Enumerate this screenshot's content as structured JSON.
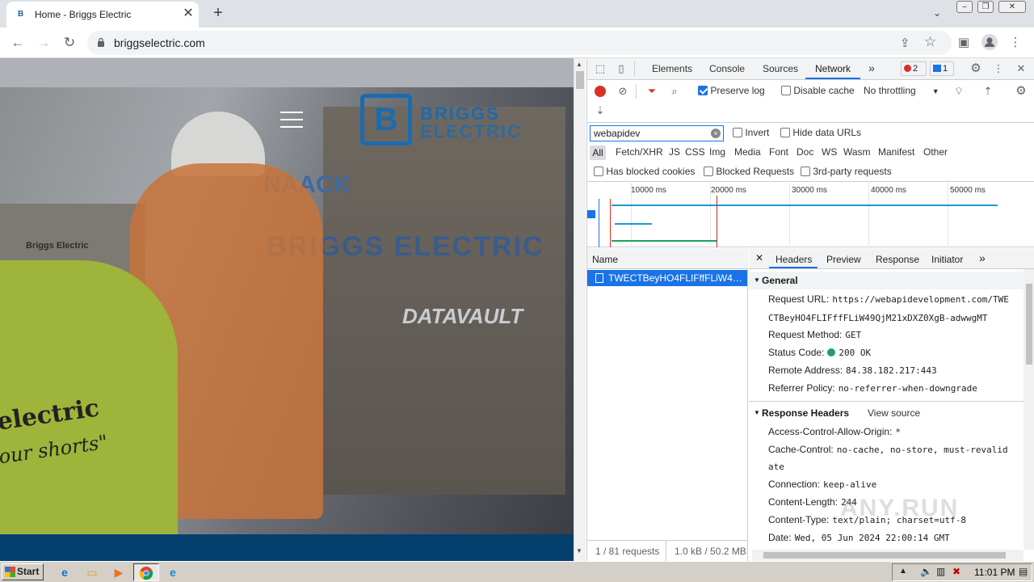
{
  "browser": {
    "tab_title": "Home - Briggs Electric",
    "favicon": "B",
    "close_glyph": "✕",
    "new_tab_glyph": "+",
    "url": "briggselectric.com"
  },
  "page": {
    "logo_line1": "BRIGGS",
    "logo_line2": "ELECTRIC",
    "logo_mark": "B",
    "wall_text": "BRIGGS ELECTRIC",
    "shirt_text": "electric",
    "shirt_text2": "our shorts\"",
    "box_text": "NAACK",
    "vault_text": "DATAVAULT",
    "small_sign": "Briggs Electric"
  },
  "devtools": {
    "tabs": [
      "Elements",
      "Console",
      "Sources",
      "Network"
    ],
    "more_glyph": "»",
    "error_count": "2",
    "message_count": "1",
    "preserve_log": "Preserve log",
    "disable_cache": "Disable cache",
    "throttling": "No throttling",
    "filter_value": "webapidev",
    "invert": "Invert",
    "hide_data_urls": "Hide data URLs",
    "types": [
      "All",
      "Fetch/XHR",
      "JS",
      "CSS",
      "Img",
      "Media",
      "Font",
      "Doc",
      "WS",
      "Wasm",
      "Manifest",
      "Other"
    ],
    "has_blocked_cookies": "Has blocked cookies",
    "blocked_requests": "Blocked Requests",
    "third_party": "3rd-party requests",
    "overview_ticks": [
      "10000 ms",
      "20000 ms",
      "30000 ms",
      "40000 ms",
      "50000 ms"
    ],
    "name_header": "Name",
    "request_name": "TWECTBeyHO4FLIFffFLiW49Q...",
    "status_requests": "1 / 81 requests",
    "status_size": "1.0 kB / 50.2 MB",
    "detail_tabs": [
      "Headers",
      "Preview",
      "Response",
      "Initiator"
    ],
    "general_title": "General",
    "general": [
      {
        "k": "Request URL:",
        "v": "https://webapidevelopment.com/TWE"
      },
      {
        "k": "",
        "v": "CTBeyHO4FLIFffFLiW49QjM21xDXZ0XgB-adwwgMT"
      },
      {
        "k": "Request Method:",
        "v": "GET"
      },
      {
        "k": "Status Code:",
        "v": "200 OK"
      },
      {
        "k": "Remote Address:",
        "v": "84.38.182.217:443"
      },
      {
        "k": "Referrer Policy:",
        "v": "no-referrer-when-downgrade"
      }
    ],
    "response_title": "Response Headers",
    "view_source": "View source",
    "response": [
      {
        "k": "Access-Control-Allow-Origin:",
        "v": "*"
      },
      {
        "k": "Cache-Control:",
        "v": "no-cache, no-store, must-revalid"
      },
      {
        "k": "",
        "v": "ate"
      },
      {
        "k": "Connection:",
        "v": "keep-alive"
      },
      {
        "k": "Content-Length:",
        "v": "244"
      },
      {
        "k": "Content-Type:",
        "v": "text/plain; charset=utf-8"
      },
      {
        "k": "Date:",
        "v": "Wed, 05 Jun 2024 22:00:14 GMT"
      }
    ]
  },
  "taskbar": {
    "start_label": "Start",
    "clock": "11:01 PM"
  },
  "watermark": "ANY.RUN",
  "colors": {
    "accent": "#1a73e8",
    "record": "#d93025",
    "status_ok": "#1aa260",
    "brand_blue": "#1b6bb0"
  }
}
